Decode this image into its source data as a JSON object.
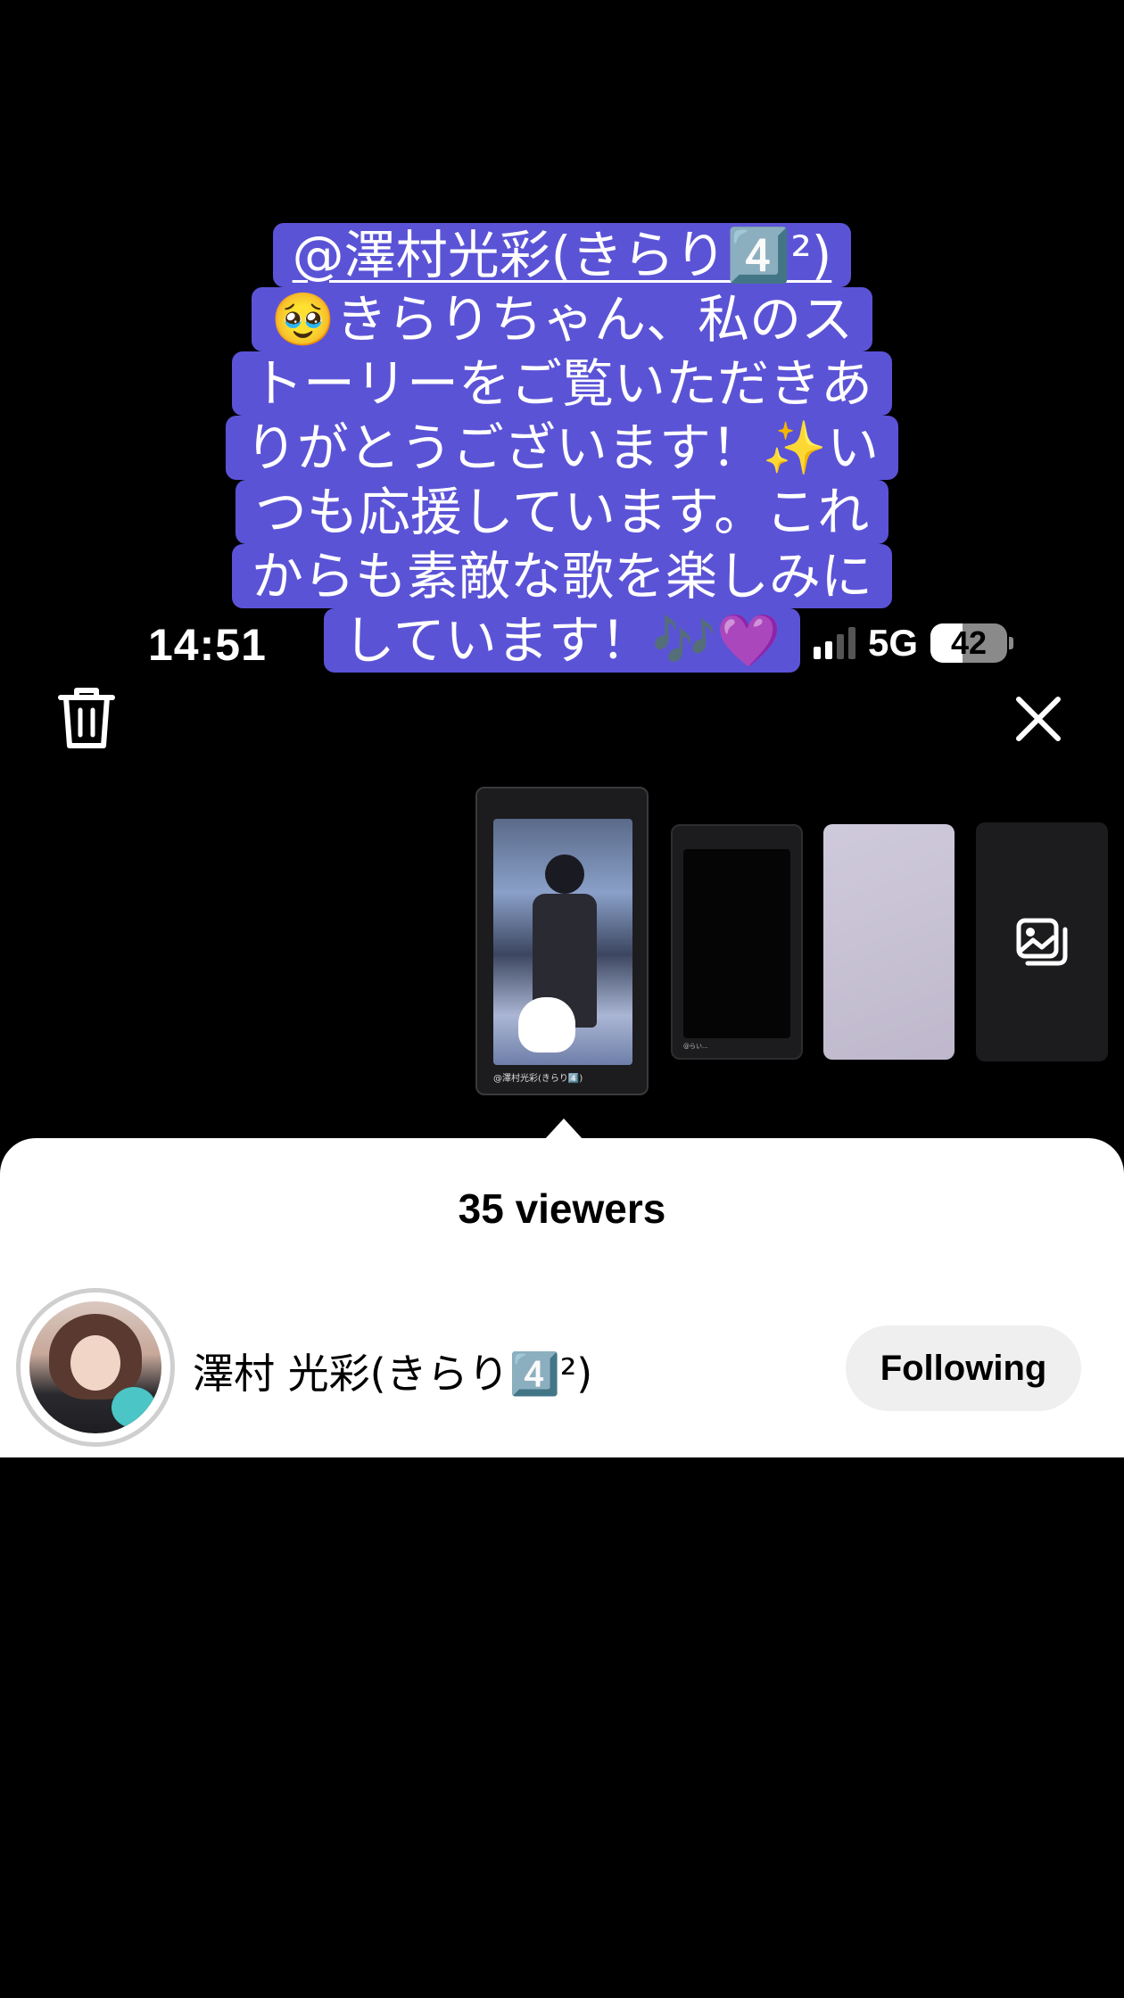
{
  "status_bar": {
    "time": "14:51",
    "network": "5G",
    "battery": "42",
    "battery_level": 0.42
  },
  "caption": {
    "mention": "@澤村光彩(きらり4️⃣²)",
    "lines": [
      "🥹きらりちゃん、私のス",
      "トーリーをご覧いただきあ",
      "りがとうございます！✨い",
      "つも応援しています。これ",
      "からも素敵な歌を楽しみに",
      "しています！🎶💜"
    ],
    "background_color": "#5b53d6"
  },
  "toolbar": {
    "delete_icon": "trash-icon",
    "close_icon": "close-icon"
  },
  "thumbnails": [
    {
      "label": "@澤村光彩(きらり4️⃣)",
      "selected": true
    },
    {
      "label": "@らい..."
    },
    {
      "label": ""
    },
    {
      "icon": "add-media-icon"
    }
  ],
  "sheet": {
    "title": "35 viewers",
    "viewers": [
      {
        "name": "澤村 光彩(きらり4️⃣²)",
        "button": "Following"
      }
    ]
  }
}
